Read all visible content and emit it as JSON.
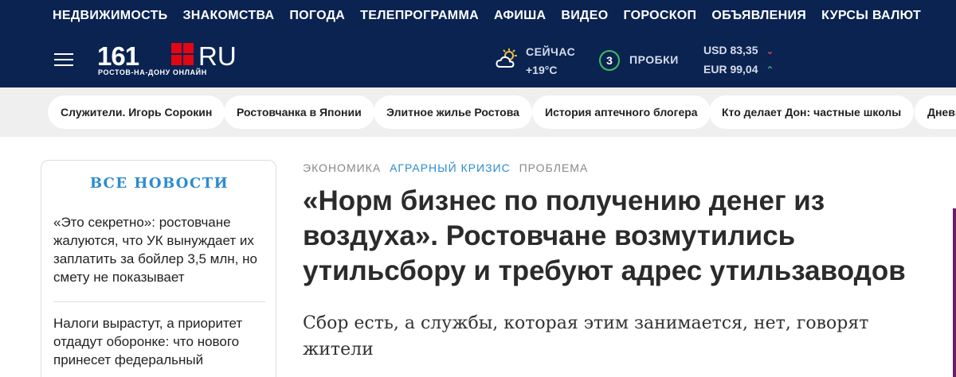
{
  "topnav": [
    "НЕДВИЖИМОСТЬ",
    "ЗНАКОМСТВА",
    "ПОГОДА",
    "ТЕЛЕПРОГРАММА",
    "АФИША",
    "ВИДЕО",
    "ГОРОСКОП",
    "ОБЪЯВЛЕНИЯ",
    "КУРСЫ ВАЛЮТ"
  ],
  "logo": {
    "number": "161",
    "domain": "RU",
    "subtitle": "РОСТОВ-НА-ДОНУ ОНЛАЙН"
  },
  "weather": {
    "label": "СЕЙЧАС",
    "temperature": "+19°С"
  },
  "traffic": {
    "level": "3",
    "label": "ПРОБКИ"
  },
  "rates": [
    {
      "text": "USD 83,35",
      "trend": "down",
      "arrow": "⌄"
    },
    {
      "text": "EUR 99,04",
      "trend": "up",
      "arrow": "⌃"
    }
  ],
  "tags": [
    "Служители. Игорь Сорокин",
    "Ростовчанка в Японии",
    "Элитное жилье Ростова",
    "История аптечного блогера",
    "Кто делает Дон: частные школы",
    "Дневн"
  ],
  "sidebar": {
    "title": "ВСЕ НОВОСТИ",
    "items": [
      "«Это секретно»: ростовчане жалуются, что УК вынуждает их заплатить за бойлер 3,5 млн, но смету не показывает",
      "Налоги вырастут, а приоритет отдадут оборонке: что нового принесет федеральный"
    ]
  },
  "article": {
    "rubrics": [
      "ЭКОНОМИКА",
      "АГРАРНЫЙ КРИЗИС",
      "ПРОБЛЕМА"
    ],
    "headline": "«Норм бизнес по получению денег из воздуха». Ростовчане возмутились утильсбору и требуют адрес утильзаводов",
    "lead": "Сбор есть, а службы, которая этим занимается, нет, говорят жители"
  },
  "colors": {
    "header_bg": "#0a2351",
    "logo_red": "#e30613",
    "accent_blue": "#2c8bd1",
    "traffic_green": "#3fbf63"
  }
}
